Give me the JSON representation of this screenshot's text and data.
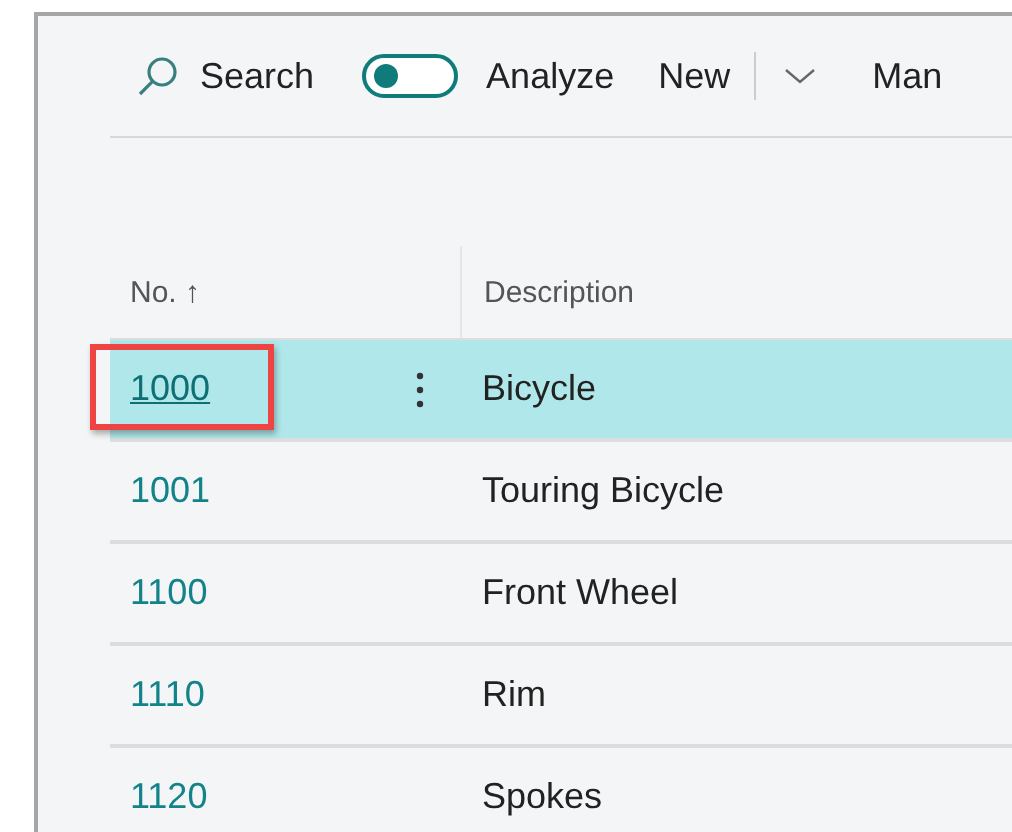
{
  "toolbar": {
    "search": "Search",
    "toggle": {
      "label": "Analyze",
      "on": false
    },
    "new": "New",
    "more": "Man"
  },
  "table": {
    "columns": [
      {
        "label": "No.",
        "sort_arrow": "↑"
      },
      {
        "label": "Description"
      }
    ],
    "rows": [
      {
        "no": "1000",
        "description": "Bicycle",
        "selected": true,
        "highlighted": true
      },
      {
        "no": "1001",
        "description": "Touring Bicycle",
        "selected": false,
        "highlighted": false
      },
      {
        "no": "1100",
        "description": "Front Wheel",
        "selected": false,
        "highlighted": false
      },
      {
        "no": "1110",
        "description": "Rim",
        "selected": false,
        "highlighted": false
      },
      {
        "no": "1120",
        "description": "Spokes",
        "selected": false,
        "highlighted": false
      }
    ]
  }
}
